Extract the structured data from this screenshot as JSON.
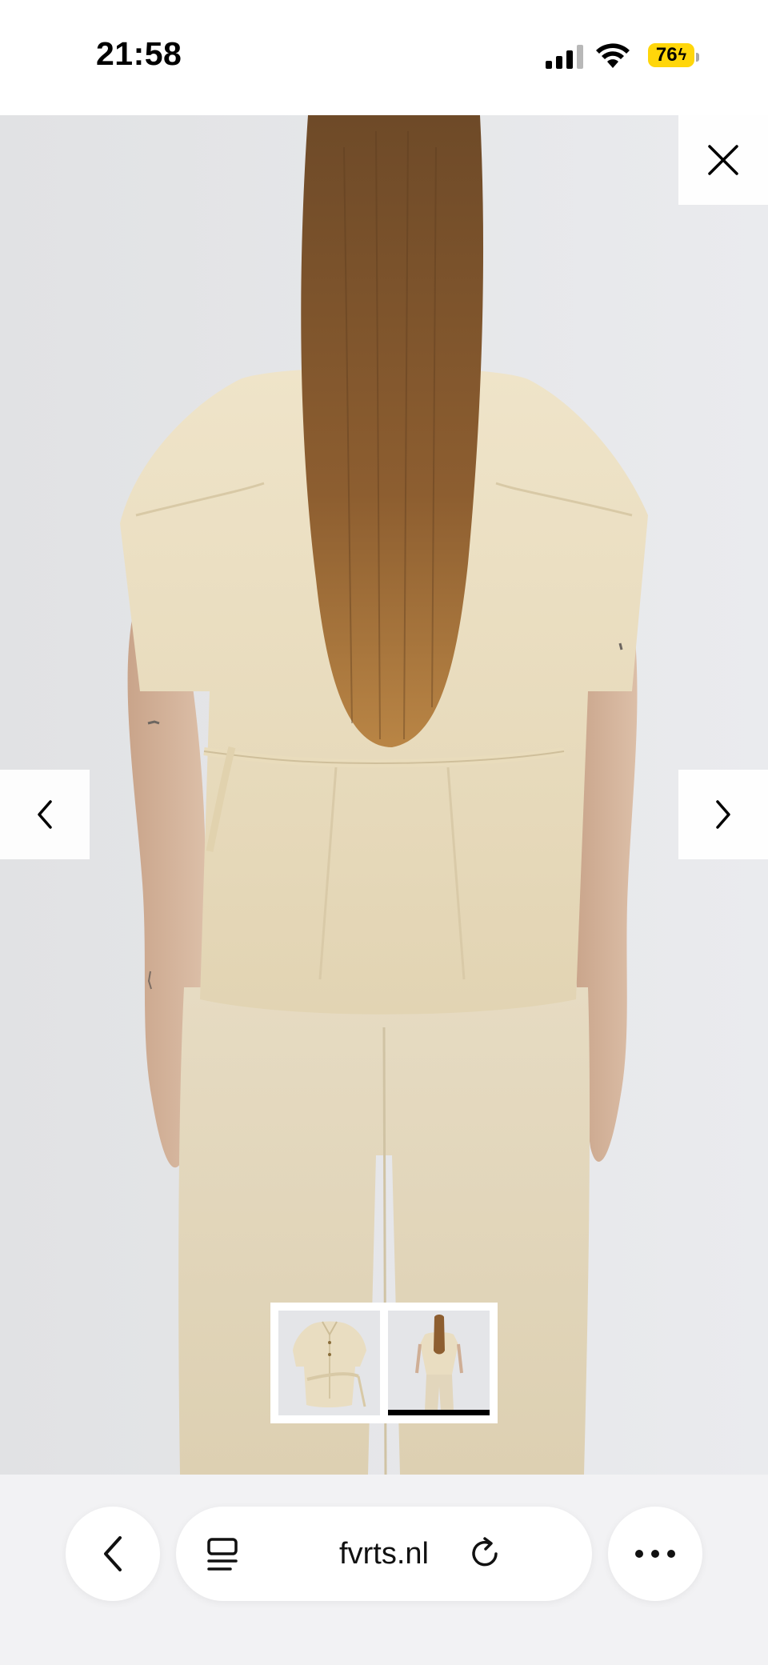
{
  "status_bar": {
    "time": "21:58",
    "battery": "76",
    "icons": [
      "signal-icon",
      "wifi-icon",
      "battery-charging-icon"
    ]
  },
  "viewer": {
    "close_icon": "close-icon",
    "prev_icon": "chevron-left-icon",
    "next_icon": "chevron-right-icon",
    "thumbnails_count": 2,
    "active_thumbnail": 2,
    "colors": {
      "background": "#e7e8eb",
      "garment": "#e3d6b8",
      "hair": "#8a5a2c"
    }
  },
  "browser": {
    "url": "fvrts.nl",
    "icons": [
      "chevron-left-icon",
      "tabs-icon",
      "reload-icon",
      "more-icon"
    ]
  }
}
